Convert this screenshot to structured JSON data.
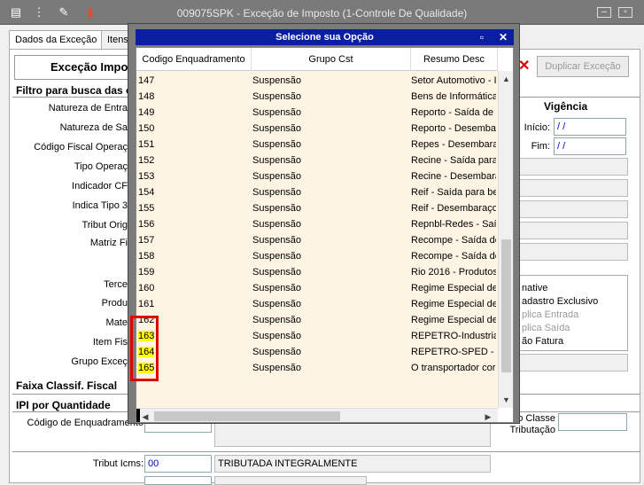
{
  "window": {
    "title": "009075SPK - Exceção de Imposto (1-Controle De Qualidade)",
    "icons": [
      "list-icon",
      "traffic-light-icon",
      "tools-icon",
      "book-icon"
    ],
    "controls": [
      "minimize-icon",
      "restore-icon"
    ]
  },
  "tabs": [
    {
      "label": "Dados da Exceção",
      "active": true
    },
    {
      "label": "Itens",
      "active": false
    }
  ],
  "form": {
    "heading": "Exceção Impo",
    "filter_section": "Filtro para busca das e",
    "fields": [
      {
        "label": "Natureza de Entra"
      },
      {
        "label": "Natureza de Sa"
      },
      {
        "label": "Código Fiscal Operaç"
      },
      {
        "label": "Tipo Operaç"
      },
      {
        "label": "Indicador CF"
      },
      {
        "label": "Indica Tipo 3"
      },
      {
        "label": "Tribut Orig"
      },
      {
        "label": "Matriz Fi"
      },
      {
        "label": "Terce"
      },
      {
        "label": "Produ"
      },
      {
        "label": "Mate"
      },
      {
        "label": "Item Fis"
      },
      {
        "label": "Grupo Exceç"
      }
    ],
    "duplicate_button": "Duplicar Exceção",
    "vigencia": {
      "title": "Vigência",
      "inicio_label": "Início:",
      "inicio_value": "/ /",
      "fim_label": "Fim:",
      "fim_value": "/ /"
    },
    "right_list": [
      "native",
      "adastro Exclusivo",
      "plica Entrada",
      "plica Saída",
      "ão Fatura"
    ],
    "faixa_section": "Faixa Classif. Fiscal",
    "ipi_section": "IPI por Quantidade",
    "codigo_enquadramento_label": "Código de Enquadramento",
    "classe_tributacao_label": "o Classe\nTributação",
    "tribut_icms_label": "Tribut Icms:",
    "tribut_icms_code": "00",
    "tribut_icms_desc": "TRIBUTADA INTEGRALMENTE"
  },
  "dialog": {
    "title": "Selecione sua Opção",
    "columns": [
      "Codigo Enquadramento",
      "Grupo Cst",
      "Resumo Desc"
    ],
    "rows": [
      {
        "code": "147",
        "grupo": "Suspensão",
        "resumo": "Setor Automotivo - I"
      },
      {
        "code": "148",
        "grupo": "Suspensão",
        "resumo": "Bens de Informática"
      },
      {
        "code": "149",
        "grupo": "Suspensão",
        "resumo": "Reporto - Saída de E"
      },
      {
        "code": "150",
        "grupo": "Suspensão",
        "resumo": "Reporto - Desembar"
      },
      {
        "code": "151",
        "grupo": "Suspensão",
        "resumo": "Repes - Desembarac"
      },
      {
        "code": "152",
        "grupo": "Suspensão",
        "resumo": "Recine - Saída para"
      },
      {
        "code": "153",
        "grupo": "Suspensão",
        "resumo": "Recine - Desembara"
      },
      {
        "code": "154",
        "grupo": "Suspensão",
        "resumo": "Reif - Saída para be"
      },
      {
        "code": "155",
        "grupo": "Suspensão",
        "resumo": "Reif - Desembaraço"
      },
      {
        "code": "156",
        "grupo": "Suspensão",
        "resumo": "Repnbl-Redes - Saíd"
      },
      {
        "code": "157",
        "grupo": "Suspensão",
        "resumo": "Recompe - Saída de"
      },
      {
        "code": "158",
        "grupo": "Suspensão",
        "resumo": "Recompe - Saída de"
      },
      {
        "code": "159",
        "grupo": "Suspensão",
        "resumo": "Rio 2016 - Produtos"
      },
      {
        "code": "160",
        "grupo": "Suspensão",
        "resumo": "Regime Especial de /"
      },
      {
        "code": "161",
        "grupo": "Suspensão",
        "resumo": "Regime Especial de /"
      },
      {
        "code": "162",
        "grupo": "Suspensão",
        "resumo": "Regime Especial de /"
      },
      {
        "code": "163",
        "grupo": "Suspensão",
        "resumo": "REPETRO-Industrial"
      },
      {
        "code": "164",
        "grupo": "Suspensão",
        "resumo": "REPETRO-SPED - Ve"
      },
      {
        "code": "165",
        "grupo": "Suspensão",
        "resumo": "O transportador cor"
      }
    ],
    "highlighted_codes": [
      "163",
      "164",
      "165"
    ],
    "highlight_color": "#ffff00",
    "annotation_color": "#e00000"
  }
}
